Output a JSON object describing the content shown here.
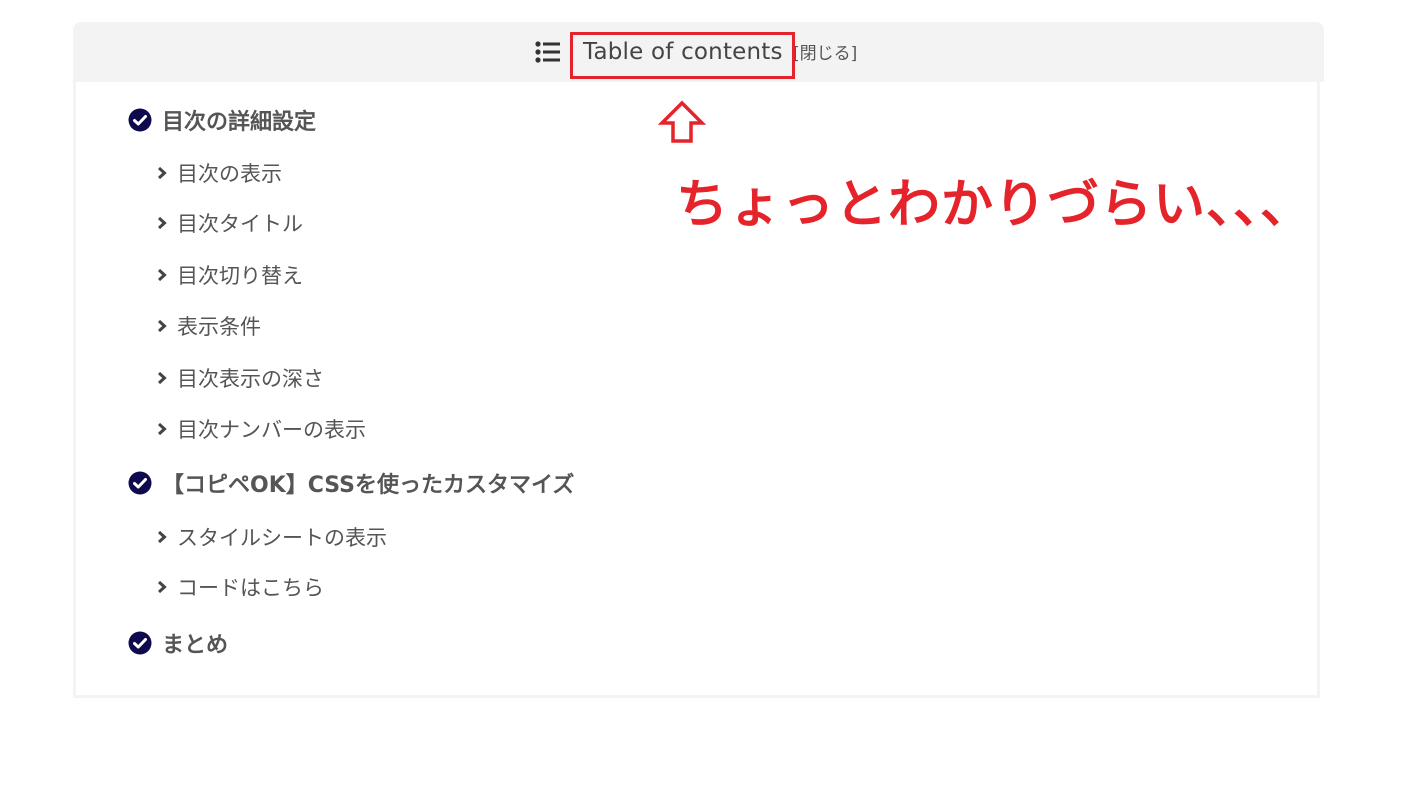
{
  "toc": {
    "header": {
      "icon": "list-icon",
      "title": "Table of contents",
      "toggle_label": "[閉じる]"
    },
    "items": [
      {
        "level": 2,
        "icon": "check-circle-icon",
        "label": "目次の詳細設定"
      },
      {
        "level": 3,
        "icon": "chevron-right-icon",
        "label": "目次の表示"
      },
      {
        "level": 3,
        "icon": "chevron-right-icon",
        "label": "目次タイトル"
      },
      {
        "level": 3,
        "icon": "chevron-right-icon",
        "label": "目次切り替え"
      },
      {
        "level": 3,
        "icon": "chevron-right-icon",
        "label": "表示条件"
      },
      {
        "level": 3,
        "icon": "chevron-right-icon",
        "label": "目次表示の深さ"
      },
      {
        "level": 3,
        "icon": "chevron-right-icon",
        "label": "目次ナンバーの表示"
      },
      {
        "level": 2,
        "icon": "check-circle-icon",
        "label": "【コピペOK】CSSを使ったカスタマイズ"
      },
      {
        "level": 3,
        "icon": "chevron-right-icon",
        "label": "スタイルシートの表示"
      },
      {
        "level": 3,
        "icon": "chevron-right-icon",
        "label": "コードはこちら"
      },
      {
        "level": 2,
        "icon": "check-circle-icon",
        "label": "まとめ"
      }
    ]
  },
  "annotation": {
    "arrow_icon": "up-arrow-icon",
    "text": "ちょっとわかりづらい、、、",
    "color": "#e5232a"
  },
  "colors": {
    "header_bg": "#f3f3f3",
    "check_icon": "#0d0a4d",
    "text": "#555555"
  }
}
